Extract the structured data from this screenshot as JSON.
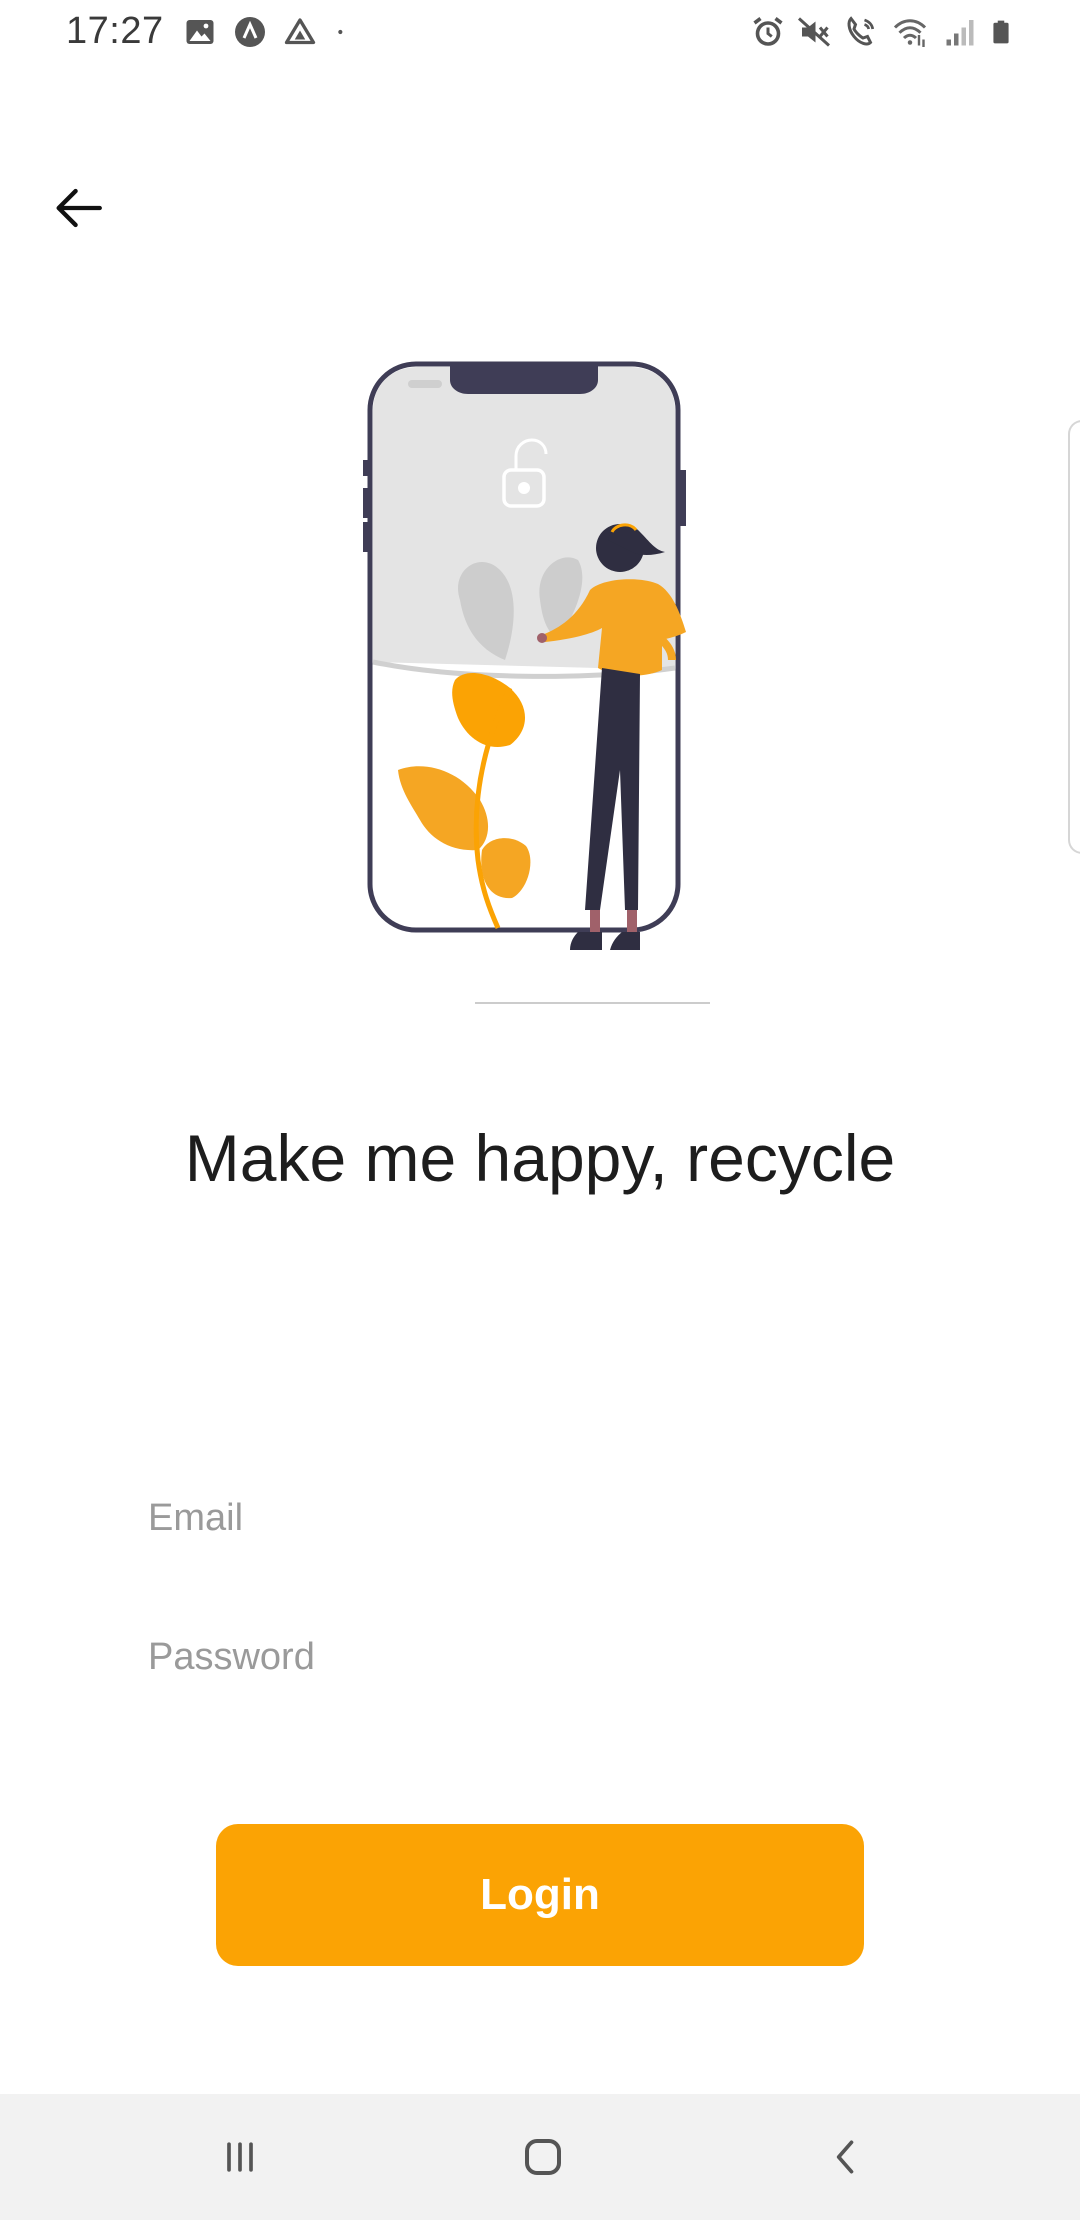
{
  "status_bar": {
    "time": "17:27",
    "left_icons": [
      "gallery-icon",
      "app-notification-icon",
      "drive-icon",
      "dot-icon"
    ],
    "right_icons": [
      "alarm-icon",
      "mute-icon",
      "wifi-calling-icon",
      "wifi-icon",
      "signal-icon",
      "battery-icon"
    ]
  },
  "header": {
    "back_icon": "arrow-left-icon"
  },
  "main": {
    "headline": "Make me happy, recycle",
    "email": {
      "value": "",
      "placeholder": "Email"
    },
    "password": {
      "value": "",
      "placeholder": "Password"
    },
    "login_label": "Login"
  },
  "colors": {
    "accent": "#FBA304",
    "illustration_dark": "#3F3D56",
    "illustration_gray": "#E0E0E0"
  },
  "nav_bar": {
    "buttons": [
      "recents-icon",
      "home-icon",
      "back-icon"
    ]
  }
}
